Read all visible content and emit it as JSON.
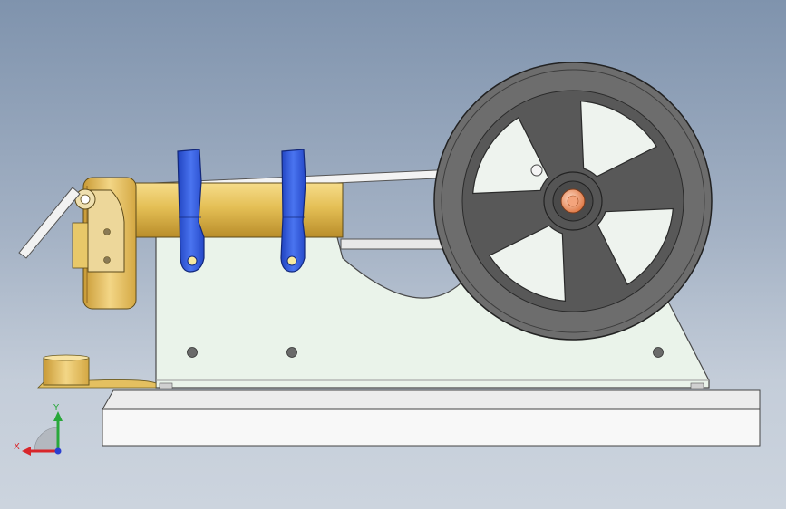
{
  "viewport": {
    "name": "cad-3d-viewport",
    "model": "steam-engine-assembly",
    "background_top": "#7f93ad",
    "background_bottom": "#ccd4de"
  },
  "parts": {
    "brass": "#e0bd5a",
    "bracket_blue": "#2f55d8",
    "flywheel_gray": "#6d6d6d",
    "frame_green": "#eaf3ea",
    "hub_copper": "#e89a70",
    "base_white": "#f8f8f8"
  },
  "triad": {
    "x_label": "X",
    "y_label": "Y",
    "x_color": "#d8262b",
    "y_color": "#29a83a",
    "z_color": "#2a3fd1"
  }
}
